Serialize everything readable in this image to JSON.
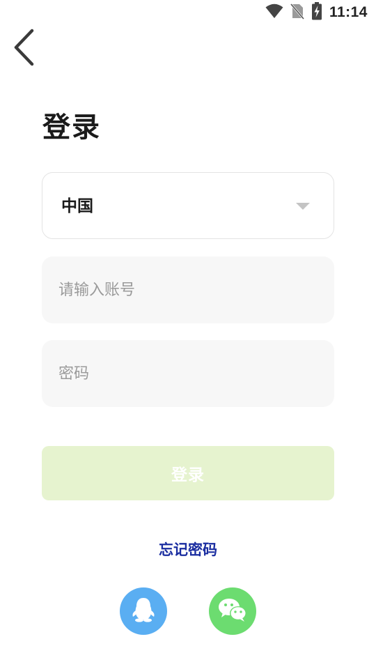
{
  "status_bar": {
    "time": "11:14",
    "icons": [
      "wifi-icon",
      "no-sim-icon",
      "battery-charging-icon"
    ]
  },
  "header": {
    "back_icon": "chevron-left-icon",
    "title": "登录"
  },
  "form": {
    "country": {
      "value": "中国",
      "icon": "dropdown-triangle-icon"
    },
    "account": {
      "value": "",
      "placeholder": "请输入账号"
    },
    "password": {
      "value": "",
      "placeholder": "密码"
    },
    "login_label": "登录",
    "login_enabled": false
  },
  "forgot_password": "忘记密码",
  "social_login": [
    {
      "name": "qq",
      "icon": "qq-penguin-icon",
      "color": "#5aaef2"
    },
    {
      "name": "wechat",
      "icon": "wechat-icon",
      "color": "#6cdc70"
    }
  ],
  "colors": {
    "accent_disabled": "#e6f3cf",
    "link": "#1a2da0",
    "input_bg": "#f7f7f7"
  }
}
